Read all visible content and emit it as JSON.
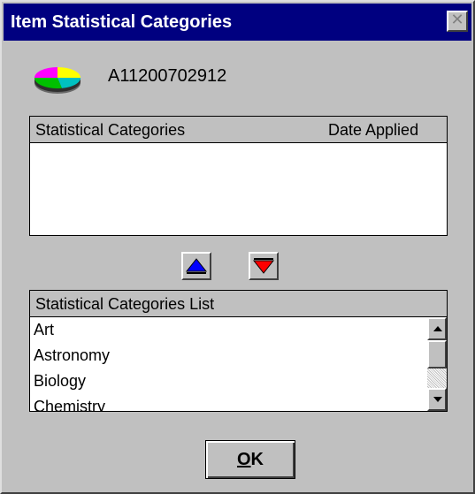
{
  "window": {
    "title": "Item Statistical Categories",
    "close_glyph": "✕"
  },
  "item": {
    "icon": "pie-chart-icon",
    "id": "A11200702912"
  },
  "applied_grid": {
    "columns": [
      "Statistical Categories",
      "Date Applied"
    ],
    "rows": []
  },
  "move_buttons": {
    "up_icon": "up-arrow-icon",
    "down_icon": "down-arrow-icon",
    "up_color": "#0000ff",
    "down_color": "#ff0000"
  },
  "categories_list": {
    "header": "Statistical Categories List",
    "items": [
      "Art",
      "Astronomy",
      "Biology",
      "Chemistry"
    ]
  },
  "ok_button": {
    "mnemonic": "O",
    "rest": "K"
  },
  "colors": {
    "title_bar": "#000080",
    "face": "#c0c0c0"
  }
}
